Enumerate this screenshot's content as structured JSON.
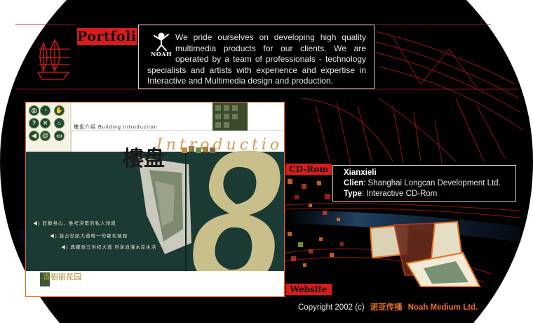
{
  "portfolio": {
    "label": "Portfolio"
  },
  "intro": {
    "logo_text": "NOAH",
    "text": "We pride ourselves on developing high quality multimedia products for our clients.  We are operated by a team of professionals - technology specialists and artists with experience and expertise in Interactive and Multimedia design and production."
  },
  "screenshot": {
    "header_text": "樓盘介绍  Building Introduction",
    "title": "Introduction",
    "big_char": "樓盘",
    "menu": [
      "◀) 匠静身心、胜考决策的私人领域",
      "◀) 独占世纪大道唯一的豪宅瑞园",
      "◀) 典藏张江世纪大道 尽享浪漫水岸生活"
    ],
    "bottom_logo": "香樹丽花园",
    "nav_icons": [
      "zoom-icon",
      "back-icon",
      "help-icon",
      "close-icon",
      "home-icon",
      "prev-icon",
      "email-icon",
      "menu-icon"
    ]
  },
  "cdrom": {
    "label": "CD-Rom"
  },
  "project": {
    "name": "Xianxieli",
    "client_label": "Clien",
    "client_value": ": Shanghai Longcan Development Ltd.",
    "type_label": "Type",
    "type_value": ": Interactive CD-Rom"
  },
  "website": {
    "label": "Website"
  },
  "footer": {
    "copyright": "Copyright 2002 (c)",
    "company_cn": "诺亚传播",
    "company_en": "Noah Medium Ltd."
  },
  "colors": {
    "accent": "#d81c1c",
    "orange": "#e7711b",
    "bg": "#000000"
  }
}
